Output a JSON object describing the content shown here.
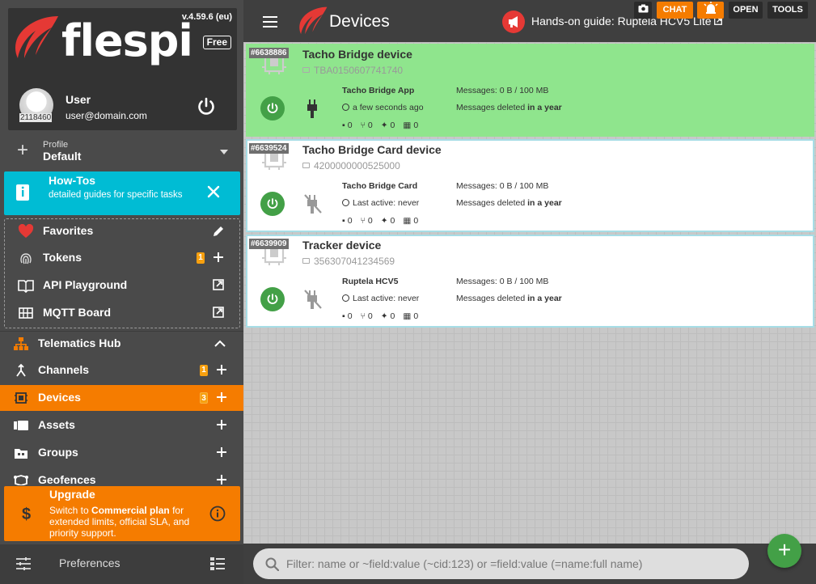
{
  "brand": {
    "name": "flespi",
    "version": "v.4.59.6 (eu)",
    "plan": "Free",
    "accent": "#e53935"
  },
  "user": {
    "id": "2118460",
    "name": "User",
    "email": "user@domain.com"
  },
  "profile": {
    "caption": "Profile",
    "value": "Default"
  },
  "howtos": {
    "title": "How-Tos",
    "description": "detailed guides for specific tasks"
  },
  "favorites": [
    {
      "label": "Favorites",
      "icon": "heart-icon",
      "action": "edit-icon"
    },
    {
      "label": "Tokens",
      "icon": "fingerprint-icon",
      "badge": "1",
      "action": "plus-icon"
    },
    {
      "label": "API Playground",
      "icon": "book-icon",
      "action": "open-external-icon"
    },
    {
      "label": "MQTT Board",
      "icon": "board-icon",
      "action": "open-external-icon"
    }
  ],
  "nav": [
    {
      "label": "Telematics Hub",
      "icon": "hub-icon",
      "action": "chevron-up-icon"
    },
    {
      "label": "Channels",
      "icon": "channels-icon",
      "badge": "1",
      "action": "plus-icon"
    },
    {
      "label": "Devices",
      "icon": "chip-icon",
      "badge": "3",
      "action": "plus-icon",
      "active": true
    },
    {
      "label": "Assets",
      "icon": "assets-icon",
      "action": "plus-icon"
    },
    {
      "label": "Groups",
      "icon": "groups-icon",
      "action": "plus-icon"
    },
    {
      "label": "Geofences",
      "icon": "geofence-icon",
      "action": "plus-icon"
    }
  ],
  "upgrade": {
    "title": "Upgrade",
    "text_pre": "Switch to ",
    "text_bold": "Commercial plan",
    "text_post": " for extended limits, official SLA, and priority support."
  },
  "preferences": {
    "label": "Preferences"
  },
  "header": {
    "title": "Devices",
    "guide": "Hands-on guide: Ruptela HCV5 Lite",
    "buttons": {
      "chat": "CHAT",
      "open": "OPEN",
      "tools": "TOOLS"
    }
  },
  "devices": [
    {
      "id": "#6638886",
      "name": "Tacho Bridge device",
      "ident": "TBA0150607741740",
      "protocol": "Tacho Bridge App",
      "last_active": "a few seconds ago",
      "messages": "Messages: 0 B / 100 MB",
      "deleted_pre": "Messages deleted ",
      "deleted_bold": "in a year",
      "counters": [
        "0",
        "0",
        "0",
        "0"
      ],
      "connected": true,
      "selected": true
    },
    {
      "id": "#6639524",
      "name": "Tacho Bridge Card device",
      "ident": "4200000000525000",
      "protocol": "Tacho Bridge Card",
      "last_active": "Last active: never",
      "messages": "Messages: 0 B / 100 MB",
      "deleted_pre": "Messages deleted ",
      "deleted_bold": "in a year",
      "counters": [
        "0",
        "0",
        "0",
        "0"
      ],
      "connected": false,
      "selected": false
    },
    {
      "id": "#6639909",
      "name": "Tracker device",
      "ident": "356307041234569",
      "protocol": "Ruptela HCV5",
      "last_active": "Last active: never",
      "messages": "Messages: 0 B / 100 MB",
      "deleted_pre": "Messages deleted ",
      "deleted_bold": "in a year",
      "counters": [
        "0",
        "0",
        "0",
        "0"
      ],
      "connected": false,
      "selected": false
    }
  ],
  "filter": {
    "placeholder": "Filter: name or ~field:value (~cid:123) or =field:value (=name:full name)"
  }
}
